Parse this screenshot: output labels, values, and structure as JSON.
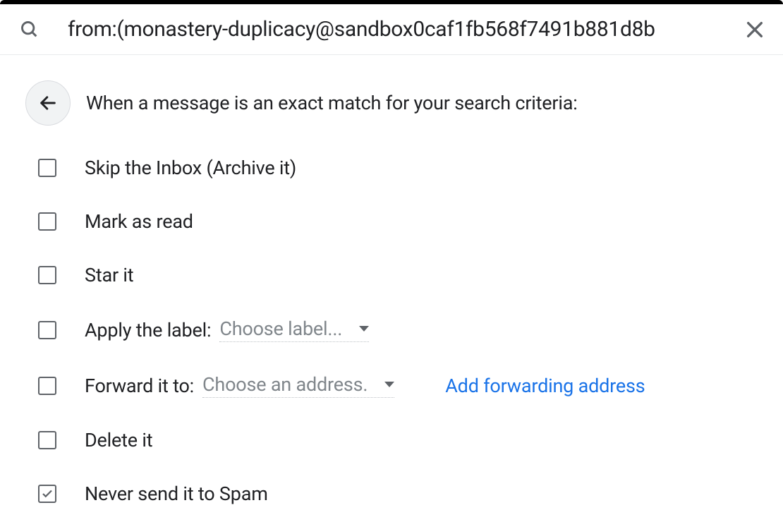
{
  "search": {
    "value": "from:(monastery-duplicacy@sandbox0caf1fb568f7491b881d8b"
  },
  "header": {
    "text": "When a message is an exact match for your search criteria:"
  },
  "options": {
    "skip_inbox": {
      "label": "Skip the Inbox (Archive it)",
      "checked": false
    },
    "mark_read": {
      "label": "Mark as read",
      "checked": false
    },
    "star": {
      "label": "Star it",
      "checked": false
    },
    "apply_label": {
      "label": "Apply the label:",
      "dropdown": "Choose label...",
      "checked": false
    },
    "forward": {
      "label": "Forward it to:",
      "dropdown": "Choose an address.",
      "link": "Add forwarding address",
      "checked": false
    },
    "delete": {
      "label": "Delete it",
      "checked": false
    },
    "never_spam": {
      "label": "Never send it to Spam",
      "checked": true
    }
  }
}
